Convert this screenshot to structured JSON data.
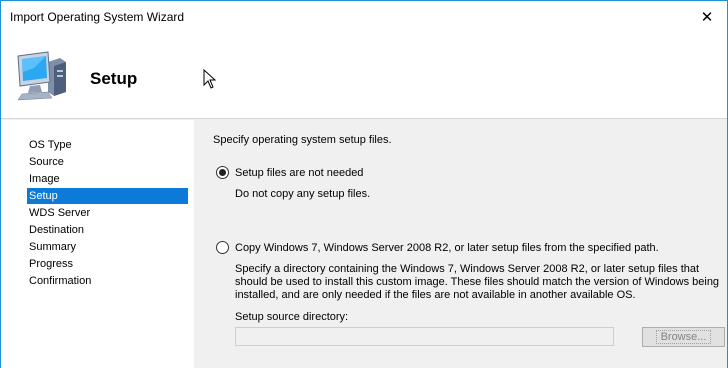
{
  "window": {
    "title": "Import Operating System Wizard",
    "close_glyph": "✕"
  },
  "header": {
    "title": "Setup",
    "icon": "computer-icon"
  },
  "nav": {
    "items": [
      {
        "label": "OS Type",
        "active": false
      },
      {
        "label": "Source",
        "active": false
      },
      {
        "label": "Image",
        "active": false
      },
      {
        "label": "Setup",
        "active": true
      },
      {
        "label": "WDS Server",
        "active": false
      },
      {
        "label": "Destination",
        "active": false
      },
      {
        "label": "Summary",
        "active": false
      },
      {
        "label": "Progress",
        "active": false
      },
      {
        "label": "Confirmation",
        "active": false
      }
    ]
  },
  "content": {
    "instruction": "Specify operating system setup files.",
    "option1": {
      "label": "Setup files are not needed",
      "description": "Do not copy any setup files.",
      "selected": true
    },
    "option2": {
      "label": "Copy Windows 7, Windows Server 2008 R2, or later setup files from the specified path.",
      "description_line1": "Specify a directory containing the Windows 7, Windows Server 2008 R2, or later setup files that",
      "description_line2": "should be used to install this custom image.  These files should match the version of Windows being",
      "description_line3": "installed, and are only needed if the files are not available in another available OS.",
      "selected": false
    },
    "source_dir_label": "Setup source directory:",
    "source_dir_value": "",
    "browse_label": "Browse..."
  },
  "colors": {
    "accent": "#0e7ad7",
    "window_border": "#1e90d6"
  }
}
